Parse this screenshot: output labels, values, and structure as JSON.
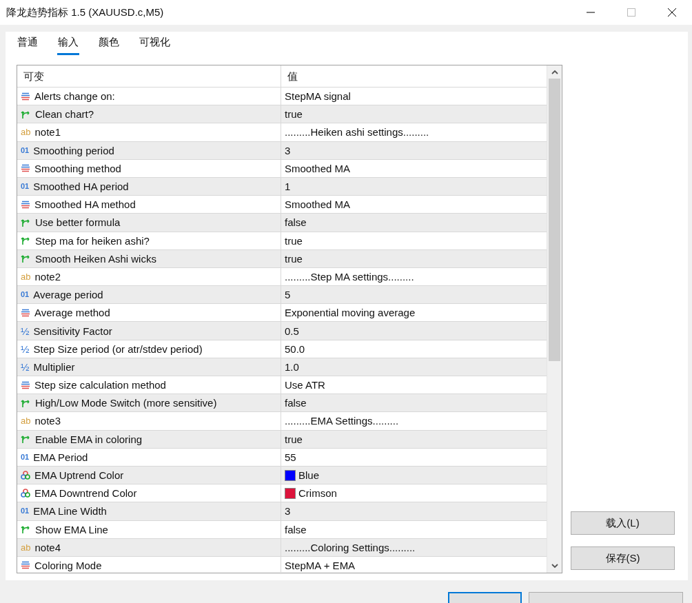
{
  "window": {
    "title": "降龙趋势指标 1.5 (XAUUSD.c,M5)"
  },
  "tabs": [
    {
      "label": "普通",
      "selected": false
    },
    {
      "label": "输入",
      "selected": true
    },
    {
      "label": "颜色",
      "selected": false
    },
    {
      "label": "可视化",
      "selected": false
    }
  ],
  "table": {
    "columns": [
      "可变",
      "值"
    ],
    "rows": [
      {
        "kind": "enum",
        "name": "Alerts change on:",
        "value": "StepMA signal"
      },
      {
        "kind": "bool",
        "name": "Clean chart?",
        "value": "true"
      },
      {
        "kind": "string",
        "icon": "ab",
        "name": "note1",
        "value": ".........Heiken ashi settings........."
      },
      {
        "kind": "int",
        "icon": "01",
        "name": "Smoothing period",
        "value": "3"
      },
      {
        "kind": "enum",
        "name": "Smoothing method",
        "value": "Smoothed MA"
      },
      {
        "kind": "int",
        "icon": "01",
        "name": "Smoothed HA period",
        "value": "1"
      },
      {
        "kind": "enum",
        "name": "Smoothed HA method",
        "value": "Smoothed MA"
      },
      {
        "kind": "bool",
        "name": "Use better formula",
        "value": "false"
      },
      {
        "kind": "bool",
        "name": "Step ma for heiken ashi?",
        "value": "true"
      },
      {
        "kind": "bool",
        "name": "Smooth Heiken Ashi wicks",
        "value": "true"
      },
      {
        "kind": "string",
        "icon": "ab",
        "name": "note2",
        "value": ".........Step MA settings........."
      },
      {
        "kind": "int",
        "icon": "01",
        "name": "Average period",
        "value": "5"
      },
      {
        "kind": "enum",
        "name": "Average method",
        "value": "Exponential moving average"
      },
      {
        "kind": "double",
        "icon": "½",
        "name": "Sensitivity Factor",
        "value": "0.5"
      },
      {
        "kind": "double",
        "icon": "½",
        "name": "Step Size period (or atr/stdev period)",
        "value": "50.0"
      },
      {
        "kind": "double",
        "icon": "½",
        "name": "Multiplier",
        "value": "1.0"
      },
      {
        "kind": "enum",
        "name": "Step size calculation method",
        "value": "Use ATR"
      },
      {
        "kind": "bool",
        "name": "High/Low Mode Switch (more sensitive)",
        "value": "false"
      },
      {
        "kind": "string",
        "icon": "ab",
        "name": "note3",
        "value": ".........EMA Settings........."
      },
      {
        "kind": "bool",
        "name": "Enable EMA in coloring",
        "value": "true"
      },
      {
        "kind": "int",
        "icon": "01",
        "name": "EMA Period",
        "value": "55"
      },
      {
        "kind": "color",
        "name": "EMA Uptrend Color",
        "value": "Blue",
        "color": "#0000ff"
      },
      {
        "kind": "color",
        "name": "EMA Downtrend Color",
        "value": "Crimson",
        "color": "#dc143c"
      },
      {
        "kind": "int",
        "icon": "01",
        "name": "EMA Line Width",
        "value": "3"
      },
      {
        "kind": "bool",
        "name": "Show EMA Line",
        "value": "false"
      },
      {
        "kind": "string",
        "icon": "ab",
        "name": "note4",
        "value": ".........Coloring Settings........."
      },
      {
        "kind": "enum",
        "name": "Coloring Mode",
        "value": "StepMA + EMA"
      }
    ]
  },
  "side_buttons": [
    "载入(L)",
    "保存(S)"
  ]
}
